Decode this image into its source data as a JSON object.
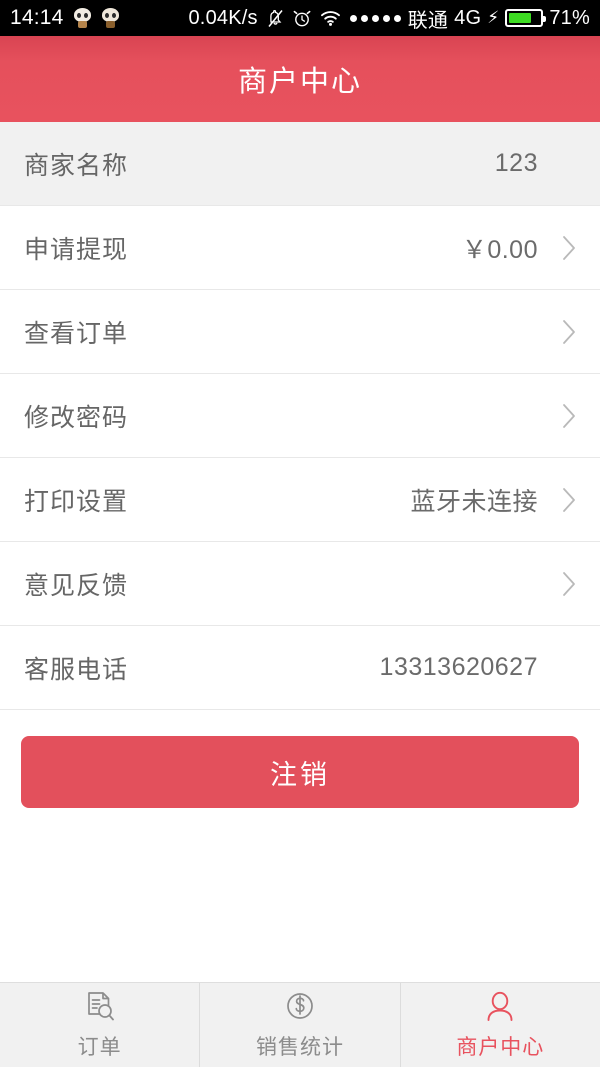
{
  "statusbar": {
    "time": "14:14",
    "emoji_icons": [
      "skull-emoji",
      "skull-emoji"
    ],
    "network_speed": "0.04K/s",
    "icons": [
      "bell-muted-icon",
      "alarm-clock-icon",
      "wifi-icon",
      "signal-dots-icon"
    ],
    "signal_dots": 5,
    "carrier": "联通",
    "network_type": "4G",
    "charging_icon": "lightning-bolt-icon",
    "battery_percent": "71%",
    "battery_level": 71,
    "battery_color": "#3ddb22"
  },
  "header": {
    "title": "商户中心",
    "background_color": "#e5505c"
  },
  "list": {
    "rows": [
      {
        "label": "商家名称",
        "value": "123",
        "chevron": false,
        "shaded": true
      },
      {
        "label": "申请提现",
        "value": "￥0.00",
        "chevron": true,
        "shaded": false
      },
      {
        "label": "查看订单",
        "value": "",
        "chevron": true,
        "shaded": false
      },
      {
        "label": "修改密码",
        "value": "",
        "chevron": true,
        "shaded": false
      },
      {
        "label": "打印设置",
        "value": "蓝牙未连接",
        "chevron": true,
        "shaded": false
      },
      {
        "label": "意见反馈",
        "value": "",
        "chevron": true,
        "shaded": false
      },
      {
        "label": "客服电话",
        "value": "13313620627",
        "chevron": false,
        "shaded": false
      }
    ]
  },
  "actions": {
    "logout_label": "注销",
    "logout_color": "#e3505c"
  },
  "tabbar": {
    "active_color": "#e8525e",
    "inactive_color": "#8c8c8c",
    "tabs": [
      {
        "label": "订单",
        "icon": "document-search-icon",
        "active": false
      },
      {
        "label": "销售统计",
        "icon": "dollar-circle-icon",
        "active": false
      },
      {
        "label": "商户中心",
        "icon": "user-person-icon",
        "active": true
      }
    ]
  }
}
